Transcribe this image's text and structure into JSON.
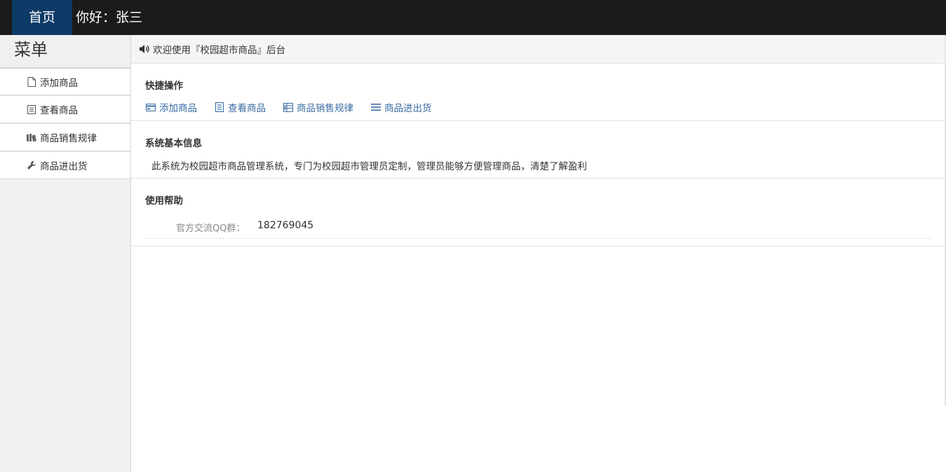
{
  "topbar": {
    "home_label": "首页",
    "greeting": "你好：张三"
  },
  "sidebar": {
    "title": "菜单",
    "items": [
      {
        "label": "添加商品",
        "icon": "file-icon"
      },
      {
        "label": "查看商品",
        "icon": "list-doc-icon"
      },
      {
        "label": "商品销售规律",
        "icon": "books-icon"
      },
      {
        "label": "商品进出货",
        "icon": "wrench-icon"
      }
    ]
  },
  "main": {
    "welcome": "欢迎使用『校园超市商品』后台",
    "quick": {
      "title": "快捷操作",
      "links": [
        {
          "label": "添加商品",
          "icon": "card-icon"
        },
        {
          "label": "查看商品",
          "icon": "list-doc-icon"
        },
        {
          "label": "商品销售规律",
          "icon": "table-icon"
        },
        {
          "label": "商品进出货",
          "icon": "menu-lines-icon"
        }
      ]
    },
    "sysinfo": {
      "title": "系统基本信息",
      "text": "此系统为校园超市商品管理系统，专门为校园超市管理员定制，管理员能够方便管理商品，清楚了解盈利"
    },
    "help": {
      "title": "使用帮助",
      "qq_label": "官方交流QQ群：",
      "qq_value": "182769045"
    }
  },
  "colors": {
    "topbar_bg": "#1b1b1b",
    "home_tab_bg": "#0d3a66",
    "link": "#3b6ea5",
    "sidebar_bg": "#f0f0f0"
  }
}
